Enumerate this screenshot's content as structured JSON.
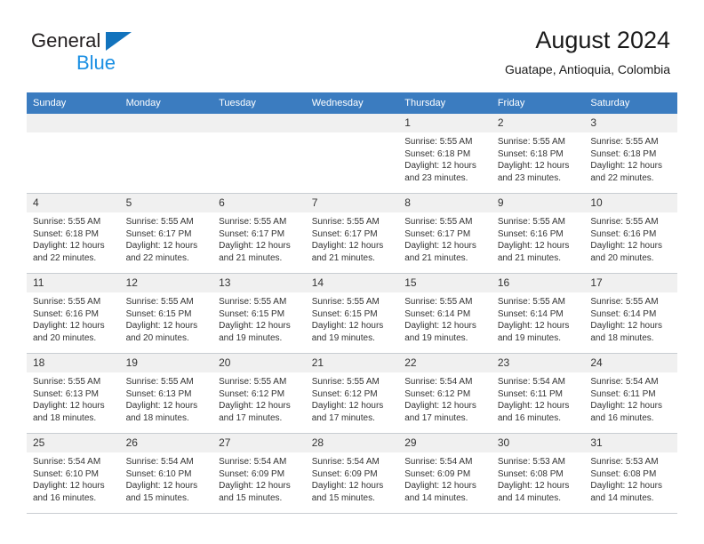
{
  "brand": {
    "line1": "General",
    "line2": "Blue",
    "logo_icon": "triangle-flag-icon",
    "colors": {
      "accent_blue": "#1273bd",
      "light_blue": "#1a8fe3",
      "header_blue": "#3b7cc0"
    }
  },
  "header": {
    "title": "August 2024",
    "subtitle": "Guatape, Antioquia, Colombia"
  },
  "weekdays": [
    "Sunday",
    "Monday",
    "Tuesday",
    "Wednesday",
    "Thursday",
    "Friday",
    "Saturday"
  ],
  "weeks": [
    [
      {
        "day": "",
        "lines": []
      },
      {
        "day": "",
        "lines": []
      },
      {
        "day": "",
        "lines": []
      },
      {
        "day": "",
        "lines": []
      },
      {
        "day": "1",
        "lines": [
          "Sunrise: 5:55 AM",
          "Sunset: 6:18 PM",
          "Daylight: 12 hours",
          "and 23 minutes."
        ]
      },
      {
        "day": "2",
        "lines": [
          "Sunrise: 5:55 AM",
          "Sunset: 6:18 PM",
          "Daylight: 12 hours",
          "and 23 minutes."
        ]
      },
      {
        "day": "3",
        "lines": [
          "Sunrise: 5:55 AM",
          "Sunset: 6:18 PM",
          "Daylight: 12 hours",
          "and 22 minutes."
        ]
      }
    ],
    [
      {
        "day": "4",
        "lines": [
          "Sunrise: 5:55 AM",
          "Sunset: 6:18 PM",
          "Daylight: 12 hours",
          "and 22 minutes."
        ]
      },
      {
        "day": "5",
        "lines": [
          "Sunrise: 5:55 AM",
          "Sunset: 6:17 PM",
          "Daylight: 12 hours",
          "and 22 minutes."
        ]
      },
      {
        "day": "6",
        "lines": [
          "Sunrise: 5:55 AM",
          "Sunset: 6:17 PM",
          "Daylight: 12 hours",
          "and 21 minutes."
        ]
      },
      {
        "day": "7",
        "lines": [
          "Sunrise: 5:55 AM",
          "Sunset: 6:17 PM",
          "Daylight: 12 hours",
          "and 21 minutes."
        ]
      },
      {
        "day": "8",
        "lines": [
          "Sunrise: 5:55 AM",
          "Sunset: 6:17 PM",
          "Daylight: 12 hours",
          "and 21 minutes."
        ]
      },
      {
        "day": "9",
        "lines": [
          "Sunrise: 5:55 AM",
          "Sunset: 6:16 PM",
          "Daylight: 12 hours",
          "and 21 minutes."
        ]
      },
      {
        "day": "10",
        "lines": [
          "Sunrise: 5:55 AM",
          "Sunset: 6:16 PM",
          "Daylight: 12 hours",
          "and 20 minutes."
        ]
      }
    ],
    [
      {
        "day": "11",
        "lines": [
          "Sunrise: 5:55 AM",
          "Sunset: 6:16 PM",
          "Daylight: 12 hours",
          "and 20 minutes."
        ]
      },
      {
        "day": "12",
        "lines": [
          "Sunrise: 5:55 AM",
          "Sunset: 6:15 PM",
          "Daylight: 12 hours",
          "and 20 minutes."
        ]
      },
      {
        "day": "13",
        "lines": [
          "Sunrise: 5:55 AM",
          "Sunset: 6:15 PM",
          "Daylight: 12 hours",
          "and 19 minutes."
        ]
      },
      {
        "day": "14",
        "lines": [
          "Sunrise: 5:55 AM",
          "Sunset: 6:15 PM",
          "Daylight: 12 hours",
          "and 19 minutes."
        ]
      },
      {
        "day": "15",
        "lines": [
          "Sunrise: 5:55 AM",
          "Sunset: 6:14 PM",
          "Daylight: 12 hours",
          "and 19 minutes."
        ]
      },
      {
        "day": "16",
        "lines": [
          "Sunrise: 5:55 AM",
          "Sunset: 6:14 PM",
          "Daylight: 12 hours",
          "and 19 minutes."
        ]
      },
      {
        "day": "17",
        "lines": [
          "Sunrise: 5:55 AM",
          "Sunset: 6:14 PM",
          "Daylight: 12 hours",
          "and 18 minutes."
        ]
      }
    ],
    [
      {
        "day": "18",
        "lines": [
          "Sunrise: 5:55 AM",
          "Sunset: 6:13 PM",
          "Daylight: 12 hours",
          "and 18 minutes."
        ]
      },
      {
        "day": "19",
        "lines": [
          "Sunrise: 5:55 AM",
          "Sunset: 6:13 PM",
          "Daylight: 12 hours",
          "and 18 minutes."
        ]
      },
      {
        "day": "20",
        "lines": [
          "Sunrise: 5:55 AM",
          "Sunset: 6:12 PM",
          "Daylight: 12 hours",
          "and 17 minutes."
        ]
      },
      {
        "day": "21",
        "lines": [
          "Sunrise: 5:55 AM",
          "Sunset: 6:12 PM",
          "Daylight: 12 hours",
          "and 17 minutes."
        ]
      },
      {
        "day": "22",
        "lines": [
          "Sunrise: 5:54 AM",
          "Sunset: 6:12 PM",
          "Daylight: 12 hours",
          "and 17 minutes."
        ]
      },
      {
        "day": "23",
        "lines": [
          "Sunrise: 5:54 AM",
          "Sunset: 6:11 PM",
          "Daylight: 12 hours",
          "and 16 minutes."
        ]
      },
      {
        "day": "24",
        "lines": [
          "Sunrise: 5:54 AM",
          "Sunset: 6:11 PM",
          "Daylight: 12 hours",
          "and 16 minutes."
        ]
      }
    ],
    [
      {
        "day": "25",
        "lines": [
          "Sunrise: 5:54 AM",
          "Sunset: 6:10 PM",
          "Daylight: 12 hours",
          "and 16 minutes."
        ]
      },
      {
        "day": "26",
        "lines": [
          "Sunrise: 5:54 AM",
          "Sunset: 6:10 PM",
          "Daylight: 12 hours",
          "and 15 minutes."
        ]
      },
      {
        "day": "27",
        "lines": [
          "Sunrise: 5:54 AM",
          "Sunset: 6:09 PM",
          "Daylight: 12 hours",
          "and 15 minutes."
        ]
      },
      {
        "day": "28",
        "lines": [
          "Sunrise: 5:54 AM",
          "Sunset: 6:09 PM",
          "Daylight: 12 hours",
          "and 15 minutes."
        ]
      },
      {
        "day": "29",
        "lines": [
          "Sunrise: 5:54 AM",
          "Sunset: 6:09 PM",
          "Daylight: 12 hours",
          "and 14 minutes."
        ]
      },
      {
        "day": "30",
        "lines": [
          "Sunrise: 5:53 AM",
          "Sunset: 6:08 PM",
          "Daylight: 12 hours",
          "and 14 minutes."
        ]
      },
      {
        "day": "31",
        "lines": [
          "Sunrise: 5:53 AM",
          "Sunset: 6:08 PM",
          "Daylight: 12 hours",
          "and 14 minutes."
        ]
      }
    ]
  ]
}
